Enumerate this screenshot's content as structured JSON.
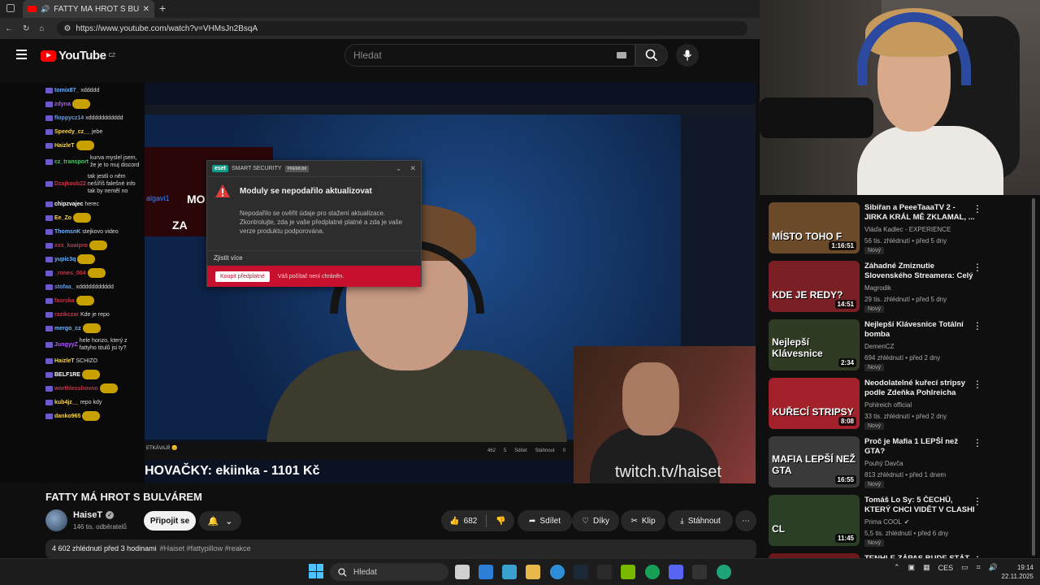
{
  "browser": {
    "tab_title": "FATTY MÁ HROT S BULVÁREM",
    "url": "https://www.youtube.com/watch?v=VHMsJn2BsqA"
  },
  "youtube": {
    "logo": "YouTube",
    "region": "CZ",
    "search_placeholder": "Hledat"
  },
  "stream": {
    "chat": [
      {
        "user": "tomix87_",
        "msg": "xddddd",
        "color": "#6fb3ff",
        "emote": false
      },
      {
        "user": "zdyna",
        "msg": "",
        "color": "#b05cff",
        "emote": true
      },
      {
        "user": "floppycz14",
        "msg": "xddddddddddd",
        "color": "#6f9bd6",
        "emote": false
      },
      {
        "user": "Speedy_cz__",
        "msg": "jebe",
        "color": "#f5d35c",
        "emote": false
      },
      {
        "user": "HaizleT",
        "msg": "",
        "color": "#f5d35c",
        "emote": true
      },
      {
        "user": "cz_transport",
        "msg": "kurva myslel jsem, že je to muj discord",
        "color": "#57c26e",
        "emote": false
      },
      {
        "user": "Dzajkoob22",
        "msg": "tak jestli o něm nešíříš falešné info tak by neměl no",
        "color": "#c0394a",
        "emote": false
      },
      {
        "user": "chipzvajec",
        "msg": "herec",
        "color": "#ffffff",
        "emote": false
      },
      {
        "user": "Ee_Zo",
        "msg": "",
        "color": "#f5d35c",
        "emote": true
      },
      {
        "user": "ThomsnK",
        "msg": "stejkovo video",
        "color": "#6fb3ff",
        "emote": false
      },
      {
        "user": "xxx_kuaipro",
        "msg": "",
        "color": "#c0394a",
        "emote": true
      },
      {
        "user": "yupic3q",
        "msg": "",
        "color": "#6fb3ff",
        "emote": true
      },
      {
        "user": "_rones_004",
        "msg": "",
        "color": "#c0394a",
        "emote": true
      },
      {
        "user": "stofaa_",
        "msg": "xddddddddddd",
        "color": "#6f9bd6",
        "emote": false
      },
      {
        "user": "fasrska",
        "msg": "",
        "color": "#c0394a",
        "emote": true
      },
      {
        "user": "razikczar",
        "msg": "Kde je repo",
        "color": "#c0394a",
        "emote": false
      },
      {
        "user": "mergo_cz",
        "msg": "",
        "color": "#6fb3ff",
        "emote": true
      },
      {
        "user": "JungyyZ",
        "msg": "hele honzo, který z fattyho titulů jsi ty?",
        "color": "#b05cff",
        "emote": false
      },
      {
        "user": "HaizleT",
        "msg": "SCHIZO",
        "color": "#f5d35c",
        "emote": false
      },
      {
        "user": "BELF1RE",
        "msg": "",
        "color": "#ffffff",
        "emote": true
      },
      {
        "user": "worthlesshovno",
        "msg": "",
        "color": "#c0394a",
        "emote": true
      },
      {
        "user": "kub4jz__",
        "msg": "repo kdy",
        "color": "#f5d35c",
        "emote": false
      },
      {
        "user": "danko965",
        "msg": "",
        "color": "#f5d35c",
        "emote": true
      }
    ],
    "overlay_name": "algavi1",
    "overlay_line1": "MO",
    "overlay_line2": "ZA",
    "bottom_left": "ETKÁVAJÍ! 😊",
    "bottom_counts": [
      "462",
      "5",
      "Sdílet",
      "Stáhnout",
      "0"
    ],
    "ticker": "HOVAČKY: ekiinka - 1101 Kč",
    "twitch": "twitch.tv/haiset"
  },
  "eset": {
    "brand": "eset",
    "product": "SMART SECURITY",
    "tier": "PREMIUM",
    "title": "Moduly se nepodařilo aktualizovat",
    "body": "Nepodařilo se ověřit údaje pro stažení aktualizace. Zkontrolujte, zda je vaše předplatné platné a zda je vaše verze produktu podporována.",
    "link": "Zjistit více",
    "buy": "Koupit předplatné",
    "status": "Váš počítač není chráněn."
  },
  "video": {
    "title": "FATTY MÁ HROT S BULVÁREM",
    "channel": "HaiseT",
    "subscribers": "146 tis. odběratelů",
    "join": "Připojit se",
    "likes": "682",
    "share": "Sdílet",
    "thanks": "Díky",
    "clip": "Klip",
    "download": "Stáhnout",
    "views_time": "4 602 zhlédnutí  před 3 hodinami",
    "tags": "#Haiset #fattypillow #reakce"
  },
  "related": [
    {
      "title": "Sibiřan a PeeeTaaaTV 2 - JIRKA KRÁL MĚ ZKLAMAL, ...",
      "channel": "Vláďa Kadlec - EXPERIENCE",
      "meta": "56 tis. zhlédnutí • před 5 dny",
      "badge": "Nový",
      "duration": "1:16:51",
      "thumb_text": "MÍSTO TOHO F",
      "thumb_bg": "#6b4a2a",
      "verified": false
    },
    {
      "title": "Záhadné Zmiznutie Slovenského Streamera: Celý ...",
      "channel": "Magrodik",
      "meta": "29 tis. zhlédnutí • před 5 dny",
      "badge": "Nový",
      "duration": "14:51",
      "thumb_text": "KDE JE REDY?",
      "thumb_bg": "#7a1f23",
      "verified": false
    },
    {
      "title": "Nejlepší Klávesnice  Totální bomba",
      "channel": "DemenCZ",
      "meta": "694 zhlédnutí • před 2 dny",
      "badge": "Nový",
      "duration": "2:34",
      "thumb_text": "Nejlepší Klávesnice",
      "thumb_bg": "#2f3b22",
      "verified": false
    },
    {
      "title": "Neodolatelné kuřecí stripsy podle Zdeňka Pohlreicha",
      "channel": "Pohlreich official",
      "meta": "33 tis. zhlédnutí • před 2 dny",
      "badge": "Nový",
      "duration": "8:08",
      "thumb_text": "KUŘECÍ STRIPSY",
      "thumb_bg": "#a3212b",
      "verified": false
    },
    {
      "title": "Proč je Mafia 1 LEPŠÍ než GTA?",
      "channel": "Pouhý Davča",
      "meta": "813 zhlédnutí • před 1 dnem",
      "badge": "Nový",
      "duration": "16:55",
      "thumb_text": "MAFIA LEPŠÍ NEŽ GTA",
      "thumb_bg": "#3a3a3a",
      "verified": false
    },
    {
      "title": "Tomáš Lo Sy: 5 ČECHŮ, KTERÝ CHCI VIDĚT V CLASHI 😊",
      "channel": "Prima COOL",
      "meta": "5,5 tis. zhlédnutí • před 6 dny",
      "badge": "Nový",
      "duration": "11:45",
      "thumb_text": "CL",
      "thumb_bg": "#2a3f25",
      "verified": true
    },
    {
      "title": "TENHLE ZÁPAS BUDE STÁT ZA ...",
      "channel": "",
      "meta": "",
      "badge": "",
      "duration": "",
      "thumb_text": "",
      "thumb_bg": "#6a1a1a",
      "verified": false
    }
  ],
  "taskbar": {
    "search": "Hledat",
    "lang": "CES",
    "time": "19:14",
    "date": "22.11.2025"
  }
}
